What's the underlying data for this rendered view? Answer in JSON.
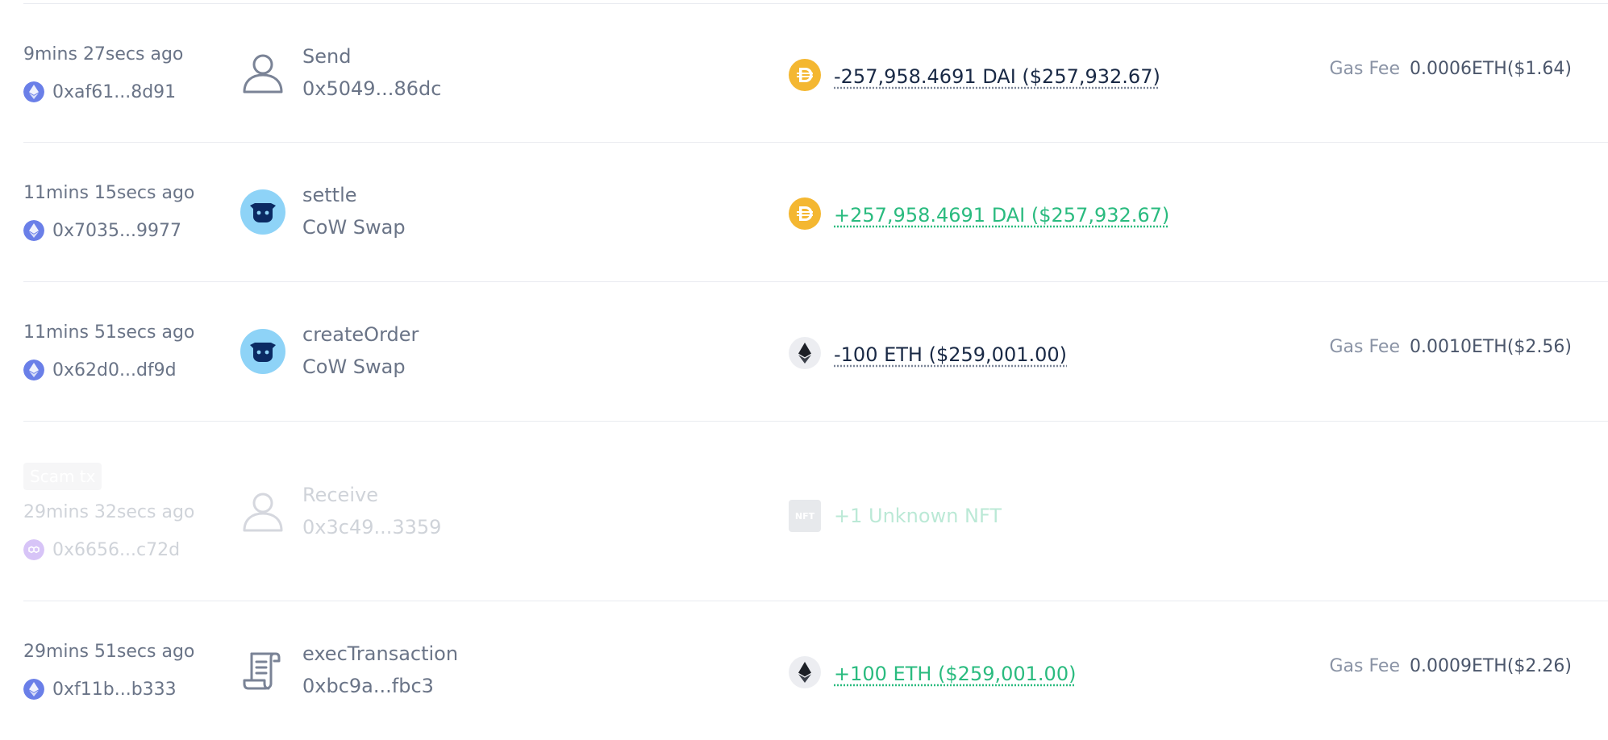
{
  "transactions": [
    {
      "time": "9mins 27secs ago",
      "hash": "0xaf61...8d91",
      "chain_icon": "ethereum-chain-icon",
      "action": "Send",
      "counterparty": "0x5049...86dc",
      "counterparty_icon": "user-icon",
      "token_icon": "dai-icon",
      "amount": "-257,958.4691 DAI ($257,932.67)",
      "gas_label": "Gas Fee",
      "gas_value": "0.0006ETH($1.64)"
    },
    {
      "time": "11mins 15secs ago",
      "hash": "0x7035...9977",
      "chain_icon": "ethereum-chain-icon",
      "action": "settle",
      "counterparty": "CoW Swap",
      "counterparty_icon": "cow-swap-icon",
      "token_icon": "dai-icon",
      "amount": "+257,958.4691 DAI ($257,932.67)"
    },
    {
      "time": "11mins 51secs ago",
      "hash": "0x62d0...df9d",
      "chain_icon": "ethereum-chain-icon",
      "action": "createOrder",
      "counterparty": "CoW Swap",
      "counterparty_icon": "cow-swap-icon",
      "token_icon": "eth-icon",
      "amount": "-100 ETH ($259,001.00)",
      "gas_label": "Gas Fee",
      "gas_value": "0.0010ETH($2.56)"
    },
    {
      "badge": "Scam tx",
      "time": "29mins 32secs ago",
      "hash": "0x6656...c72d",
      "chain_icon": "polygon-chain-icon",
      "action": "Receive",
      "counterparty": "0x3c49...3359",
      "counterparty_icon": "user-icon",
      "token_icon": "nft-icon",
      "token_icon_text": "NFT",
      "amount": "+1 Unknown NFT"
    },
    {
      "time": "29mins 51secs ago",
      "hash": "0xf11b...b333",
      "chain_icon": "ethereum-chain-icon",
      "action": "execTransaction",
      "counterparty": "0xbc9a...fbc3",
      "counterparty_icon": "contract-icon",
      "token_icon": "eth-icon",
      "amount": "+100 ETH ($259,001.00)",
      "gas_label": "Gas Fee",
      "gas_value": "0.0009ETH($2.26)"
    }
  ],
  "colors": {
    "negative": "#192945",
    "positive": "#2abb7f",
    "muted": "#6a7487",
    "ethereum": "#6a7fe8",
    "polygon": "#8247e5",
    "dai": "#f4b731",
    "cow": "#8ed3f7"
  }
}
